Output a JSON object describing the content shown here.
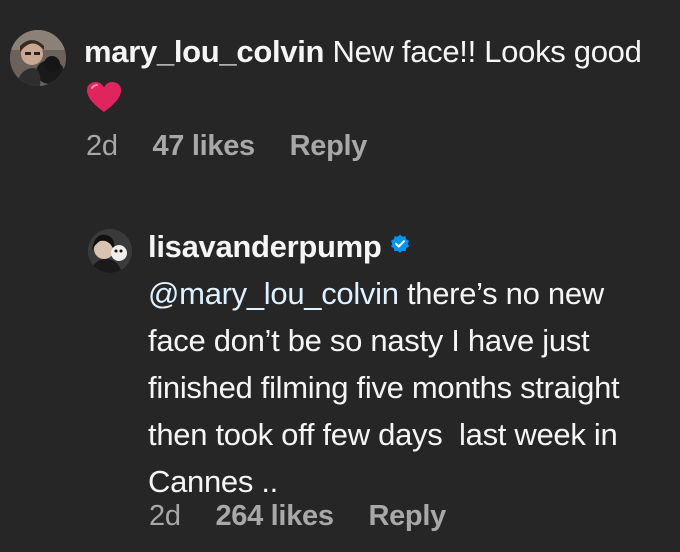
{
  "comments": [
    {
      "username": "mary_lou_colvin",
      "text": "New face!! Looks good",
      "emoji": "red-heart",
      "time": "2d",
      "likes": "47 likes",
      "reply": "Reply"
    },
    {
      "username": "lisavanderpump",
      "verified": true,
      "mention": "@mary_lou_colvin",
      "text": " there’s no new face don’t be so nasty I have just finished filming five months straight then took off few days  last week in Cannes ..",
      "time": "2d",
      "likes": "264 likes",
      "reply": "Reply"
    }
  ],
  "colors": {
    "background": "#262626",
    "text": "#f5f5f5",
    "meta": "#a8a8a8",
    "mention": "#e0f1ff",
    "verified": "#0095f6",
    "heart": "#e0245e"
  }
}
